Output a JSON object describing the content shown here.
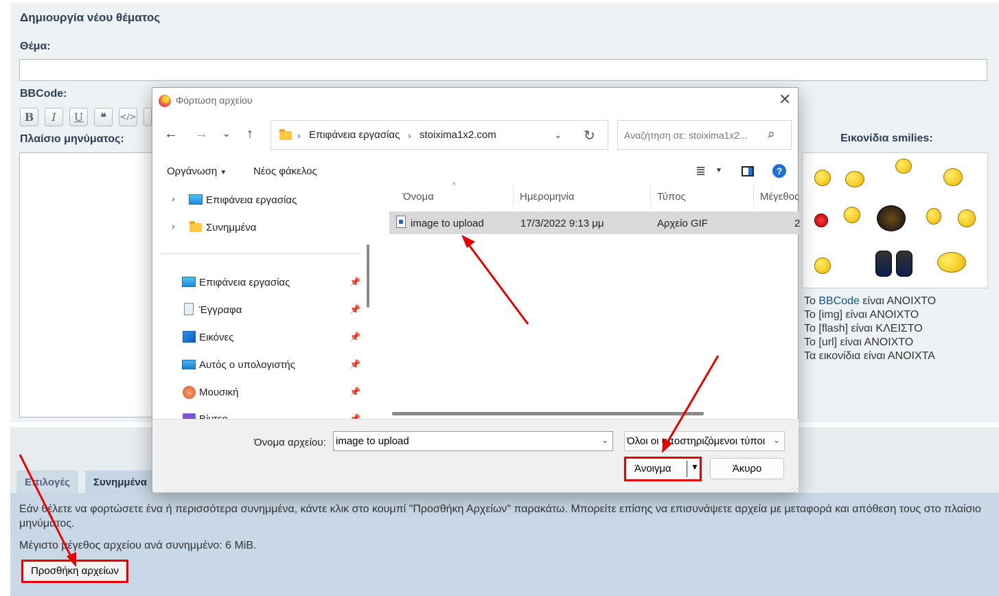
{
  "forum": {
    "title": "Δημιουργία νέου θέματος",
    "subject_label": "Θέμα:",
    "bbcode_label": "BBCode:",
    "bbcode_buttons": {
      "bold": "B",
      "italic": "I",
      "underline": "U",
      "quote": "❝",
      "code": "</>"
    },
    "message_label": "Πλαίσιο μηνύματος:",
    "smilies_label": "Εικονίδια smilies:",
    "status": {
      "bbcode_prefix": "Το ",
      "bbcode_link": "BBCode",
      "bbcode_suffix": " είναι ΑΝΟΙΧΤΟ",
      "img": "Το [img] είναι ΑΝΟΙΧΤΟ",
      "flash": "Το [flash] είναι ΚΛΕΙΣΤΟ",
      "url": "Το [url] είναι ΑΝΟΙΧΤΟ",
      "smilies": "Τα εικονίδια είναι ΑΝΟΙΧΤΑ"
    },
    "tabs": [
      "Επιλογές",
      "Συνημμένα"
    ],
    "attach_help": "Εάν θέλετε να φορτώσετε ένα ή περισσότερα συνημμένα, κάντε κλικ στο κουμπί \"Προσθήκη Αρχείων\" παρακάτω. Μπορείτε επίσης να επισυνάψετε αρχεία με μεταφορά και απόθεση τους στο πλαίσιο μηνύματος.",
    "max_size": "Μέγιστο μέγεθος αρχείου ανά συνημμένο: 6 MiB.",
    "add_files_button": "Προσθήκη αρχείων"
  },
  "dialog": {
    "title": "Φόρτωση αρχείου",
    "breadcrumb": [
      "Επιφάνεια εργασίας",
      "stoixima1x2.com"
    ],
    "search_placeholder": "Αναζήτηση σε: stoixima1x2...",
    "toolbar": {
      "organize": "Οργάνωση",
      "new_folder": "Νέος φάκελος"
    },
    "nav_top": [
      "Επιφάνεια εργασίας",
      "Συνημμένα"
    ],
    "nav_quick": [
      "Επιφάνεια εργασίας",
      "Έγγραφα",
      "Εικόνες",
      "Αυτός ο υπολογιστής",
      "Μουσική",
      "Βίντεο"
    ],
    "columns": [
      "Όνομα",
      "Ημερομηνία",
      "Τύπος",
      "Μέγεθος"
    ],
    "files": [
      {
        "name": "image to upload",
        "date": "17/3/2022 9:13 μμ",
        "type": "Αρχείο GIF",
        "size": "2"
      }
    ],
    "filename_label": "Όνομα αρχείου:",
    "filename_value": "image to upload",
    "filetype_value": "Όλοι οι υποστηριζόμενοι τύποι",
    "open_button": "Άνοιγμα",
    "cancel_button": "Άκυρο"
  },
  "colors": {
    "annotation_red": "#e60000",
    "accent_blue": "#1f6fd6",
    "link_blue": "#105289"
  }
}
